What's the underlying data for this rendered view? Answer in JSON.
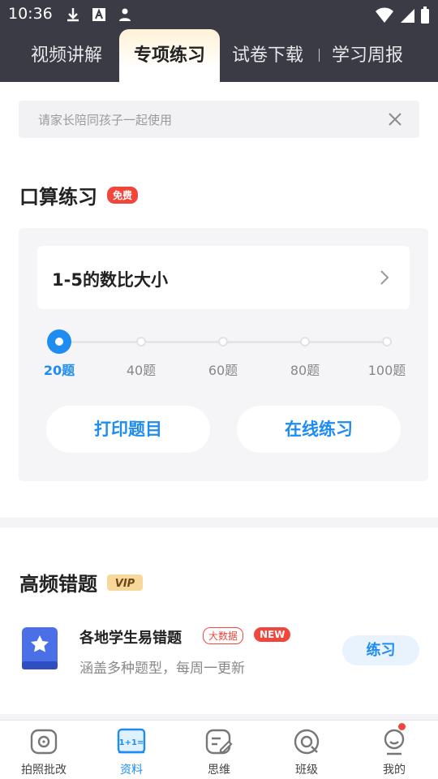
{
  "status_bar": {
    "time": "10:36",
    "icons": [
      "download-icon",
      "font-a-icon",
      "person-icon",
      "wifi-icon",
      "signal-icon",
      "battery-icon"
    ]
  },
  "tabs": [
    {
      "label": "视频讲解",
      "active": false
    },
    {
      "label": "专项练习",
      "active": true
    },
    {
      "label": "试卷下载",
      "active": false
    },
    {
      "label": "学习周报",
      "active": false
    }
  ],
  "notice": {
    "text": "请家长陪同孩子一起使用"
  },
  "oral_practice": {
    "title": "口算练习",
    "badge": "免费",
    "topic": "1-5的数比大小",
    "slider": {
      "selected": 0,
      "stops": [
        "20题",
        "40题",
        "60题",
        "80题",
        "100题"
      ]
    },
    "print_button": "打印题目",
    "online_button": "在线练习"
  },
  "frequent_errors": {
    "title": "高频错题",
    "badge": "VIP",
    "item": {
      "title": "各地学生易错题",
      "tag_bigdata": "大数据",
      "tag_new": "NEW",
      "subtitle": "涵盖多种题型，每周一更新",
      "button": "练习"
    }
  },
  "bottom_nav": [
    {
      "label": "拍照批改",
      "icon": "camera-icon",
      "active": false
    },
    {
      "label": "资料",
      "icon": "math-book-icon",
      "active": true
    },
    {
      "label": "思维",
      "icon": "edit-card-icon",
      "active": false
    },
    {
      "label": "班级",
      "icon": "class-icon",
      "active": false
    },
    {
      "label": "我的",
      "icon": "profile-icon",
      "active": false
    }
  ],
  "colors": {
    "accent": "#1e8cf0",
    "badge_red": "#f1463c",
    "header_bg": "#3a3b45"
  }
}
